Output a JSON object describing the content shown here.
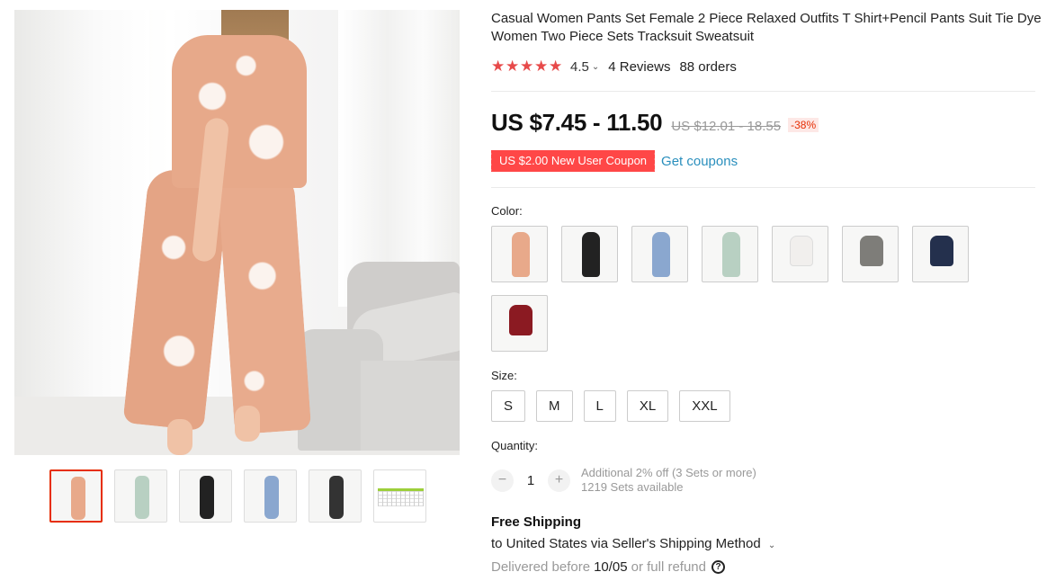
{
  "product": {
    "title": "Casual Women Pants Set Female 2 Piece Relaxed Outfits T Shirt+Pencil Pants Suit Tie Dye Women Two Piece Sets Tracksuit Sweatsuit",
    "rating": {
      "stars": 4.5,
      "value": "4.5",
      "reviews": "4 Reviews",
      "orders": "88 orders"
    },
    "price": {
      "current": "US $7.45 - 11.50",
      "original": "US $12.01 - 18.55",
      "discount": "-38%"
    },
    "coupon": {
      "label": "US $2.00 New User Coupon",
      "link": "Get coupons"
    },
    "color_label": "Color:",
    "colors": [
      {
        "name": "tie-dye-pink",
        "color": "#e8a98a"
      },
      {
        "name": "black",
        "color": "#222222"
      },
      {
        "name": "tie-dye-blue",
        "color": "#8aa7cf"
      },
      {
        "name": "tie-dye-green",
        "color": "#b8d0c2"
      },
      {
        "name": "white-shorts",
        "color": "#f1efed"
      },
      {
        "name": "gray-shorts",
        "color": "#7e7d79"
      },
      {
        "name": "navy-shorts",
        "color": "#24304d"
      },
      {
        "name": "wine-red-shorts",
        "color": "#8b1a22"
      }
    ],
    "size_label": "Size:",
    "sizes": [
      "S",
      "M",
      "L",
      "XL",
      "XXL"
    ],
    "quantity": {
      "label": "Quantity:",
      "minus": "−",
      "value": "1",
      "plus": "+",
      "offer": "Additional 2% off (3 Sets or more)",
      "available": "1219 Sets available"
    },
    "shipping": {
      "title": "Free Shipping",
      "method": "to United States via Seller's Shipping Method",
      "delivered_prefix": "Delivered before",
      "delivered_date": "10/05",
      "delivered_suffix": "or full refund",
      "help_icon": "?"
    }
  },
  "gallery": {
    "thumbnails": [
      {
        "name": "tie-dye-pink",
        "color": "#e8a98a"
      },
      {
        "name": "tie-dye-green",
        "color": "#b8d0c2"
      },
      {
        "name": "black",
        "color": "#222222"
      },
      {
        "name": "tie-dye-blue",
        "color": "#8aa7cf"
      },
      {
        "name": "black-tie-dye",
        "color": "#333333"
      },
      {
        "name": "size-chart",
        "color": "#9ccf3a"
      }
    ]
  },
  "ui": {
    "star_icon": "★",
    "chevron_icon": "⌄",
    "accent": "#e62e04",
    "star_color": "#e74a4a",
    "link_color": "#2a8fbd"
  }
}
